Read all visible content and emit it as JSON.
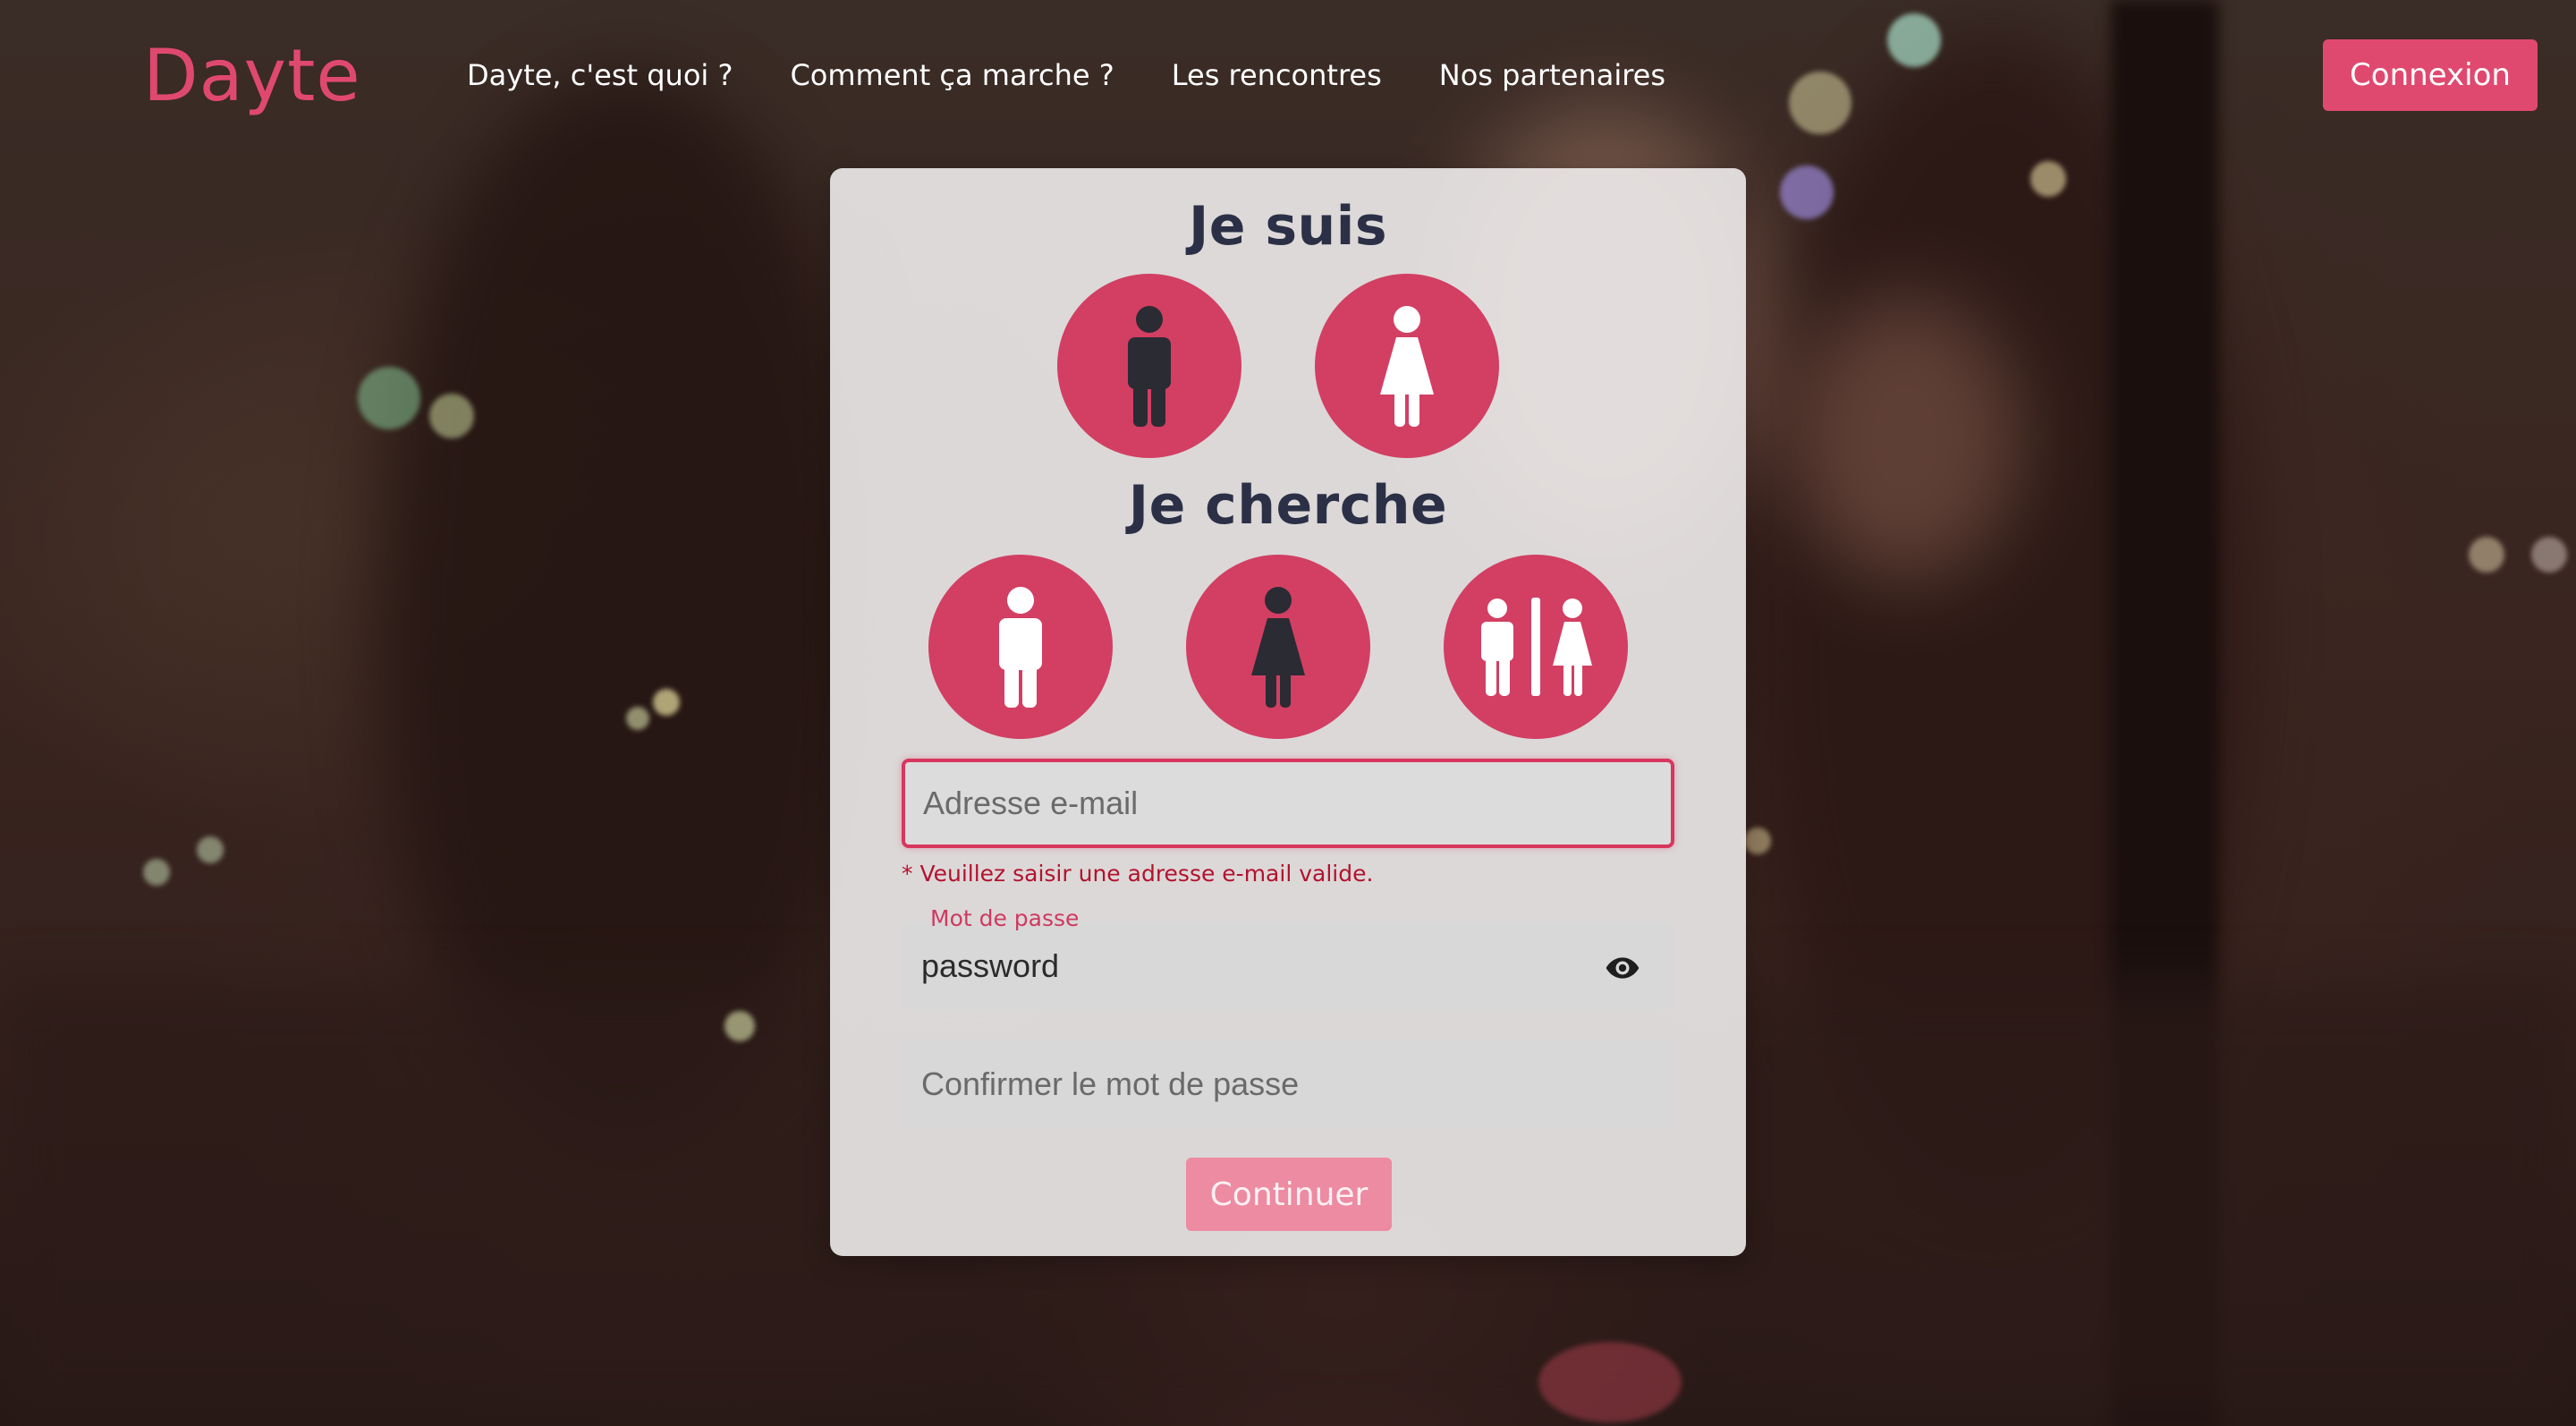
{
  "brand": {
    "name": "Dayte",
    "color": "#e0496f"
  },
  "nav": {
    "items": [
      {
        "label": "Dayte, c'est quoi ?"
      },
      {
        "label": "Comment ça marche ?"
      },
      {
        "label": "Les rencontres"
      },
      {
        "label": "Nos partenaires"
      }
    ],
    "login_label": "Connexion"
  },
  "form": {
    "i_am": {
      "title": "Je suis",
      "options": [
        {
          "icon": "male-icon",
          "selected": true
        },
        {
          "icon": "female-icon",
          "selected": false
        }
      ]
    },
    "looking_for": {
      "title": "Je cherche",
      "options": [
        {
          "icon": "male-icon",
          "selected": false
        },
        {
          "icon": "female-icon",
          "selected": true
        },
        {
          "icon": "couple-icon",
          "selected": false
        }
      ]
    },
    "email": {
      "placeholder": "Adresse e-mail",
      "value": "",
      "error": "* Veuillez saisir une adresse e-mail valide."
    },
    "password": {
      "label": "Mot de passe",
      "value": "password",
      "toggle_icon": "eye-icon"
    },
    "confirm_password": {
      "placeholder": "Confirmer le mot de passe",
      "value": ""
    },
    "submit_label": "Continuer"
  },
  "colors": {
    "accent": "#d23f63",
    "error": "#b3122e",
    "title": "#2b3046",
    "button_disabled": "#ec8ba2"
  }
}
